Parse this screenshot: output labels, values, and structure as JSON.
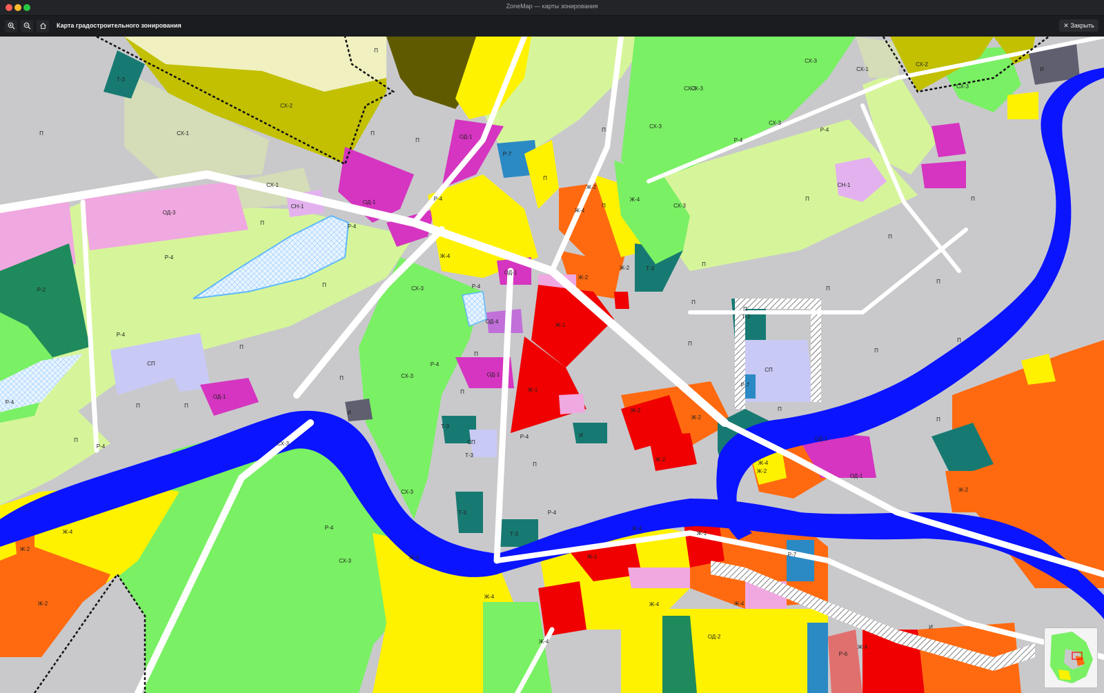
{
  "window": {
    "title": "ZoneMap — карты зонирования"
  },
  "toolbar": {
    "zoom_in_icon": "zoom-in-icon",
    "zoom_out_icon": "zoom-out-icon",
    "home_icon": "home-icon",
    "map_title": "Карта градостроительного зонирования",
    "close_label": "Закрыть"
  },
  "colors": {
    "П": "#c9c9cc",
    "Ж-1": "#f00000",
    "Ж-2": "#ff6a10",
    "Ж-4": "#fff200",
    "ОД-1": "#d535c0",
    "ОД-2": "#a84bb8",
    "ОД-3": "#f0a8e0",
    "ОД-4": "#c070d8",
    "СХ-1": "#d4dcb8",
    "СХ-2": "#c2c000",
    "СХ-3": "#7af064",
    "Р-2": "#1f8a5c",
    "Р-4": "#d6f59a",
    "Р-6": "#e0706e",
    "Р-7": "#2b8ac4",
    "Т-3": "#177a72",
    "И": "#5f5f6f",
    "СП": "#c9c9f5",
    "СН-1": "#e3b2ee",
    "water": "#0a14ff",
    "road": "#ffffff"
  },
  "labels": [
    {
      "t": "П"
    },
    {
      "t": "П"
    },
    {
      "t": "П"
    },
    {
      "t": "П"
    },
    {
      "t": "П"
    },
    {
      "t": "П"
    },
    {
      "t": "П"
    },
    {
      "t": "П"
    },
    {
      "t": "П"
    },
    {
      "t": "П"
    },
    {
      "t": "П"
    },
    {
      "t": "П"
    },
    {
      "t": "П"
    },
    {
      "t": "П"
    },
    {
      "t": "П"
    },
    {
      "t": "П"
    },
    {
      "t": "П"
    },
    {
      "t": "П"
    },
    {
      "t": "П"
    },
    {
      "t": "П"
    },
    {
      "t": "П"
    },
    {
      "t": "П"
    },
    {
      "t": "П"
    },
    {
      "t": "П"
    },
    {
      "t": "П"
    },
    {
      "t": "П"
    },
    {
      "t": "П"
    },
    {
      "t": "П"
    },
    {
      "t": "П"
    },
    {
      "t": "П"
    },
    {
      "t": "СХ-2"
    },
    {
      "t": "СХ-1"
    },
    {
      "t": "СХ-1"
    },
    {
      "t": "СХ-3"
    },
    {
      "t": "СХ-3"
    },
    {
      "t": "СХ-3"
    },
    {
      "t": "СХ-3"
    },
    {
      "t": "СХ-3"
    },
    {
      "t": "СХ-3"
    },
    {
      "t": "СХ-1"
    },
    {
      "t": "СХ-2"
    },
    {
      "t": "СХ-3"
    },
    {
      "t": "СХ-3"
    },
    {
      "t": "СХ-3"
    },
    {
      "t": "СХ-3"
    },
    {
      "t": "СХ-3"
    },
    {
      "t": "СХ-3"
    },
    {
      "t": "ОД-3"
    },
    {
      "t": "ОД-1"
    },
    {
      "t": "ОД-1"
    },
    {
      "t": "ОД-1"
    },
    {
      "t": "ОД-1"
    },
    {
      "t": "ОД-1"
    },
    {
      "t": "ОД-1"
    },
    {
      "t": "ОД-1"
    },
    {
      "t": "ОД-2"
    },
    {
      "t": "Р-4"
    },
    {
      "t": "Р-4"
    },
    {
      "t": "Р-4"
    },
    {
      "t": "Р-4"
    },
    {
      "t": "Р-4"
    },
    {
      "t": "Р-4"
    },
    {
      "t": "Р-4"
    },
    {
      "t": "Р-4"
    },
    {
      "t": "Р-4"
    },
    {
      "t": "Р-4"
    },
    {
      "t": "Р-4"
    },
    {
      "t": "Р-4"
    },
    {
      "t": "Р-4"
    },
    {
      "t": "Р-2"
    },
    {
      "t": "Р-7"
    },
    {
      "t": "Р-7"
    },
    {
      "t": "Р-7"
    },
    {
      "t": "Р-6"
    },
    {
      "t": "Ж-1"
    },
    {
      "t": "Ж-1"
    },
    {
      "t": "Ж-1"
    },
    {
      "t": "Ж-1"
    },
    {
      "t": "Ж-2"
    },
    {
      "t": "Ж-2"
    },
    {
      "t": "Ж-2"
    },
    {
      "t": "Ж-2"
    },
    {
      "t": "Ж-2"
    },
    {
      "t": "Ж-2"
    },
    {
      "t": "Ж-2"
    },
    {
      "t": "Ж-2"
    },
    {
      "t": "Ж-2"
    },
    {
      "t": "Ж-2"
    },
    {
      "t": "Ж-4"
    },
    {
      "t": "Ж-4"
    },
    {
      "t": "Ж-4"
    },
    {
      "t": "Ж-4"
    },
    {
      "t": "Ж-4"
    },
    {
      "t": "Ж-4"
    },
    {
      "t": "Ж-4"
    },
    {
      "t": "Ж-4"
    },
    {
      "t": "Ж-4"
    },
    {
      "t": "Ж-4"
    },
    {
      "t": "Ж-4"
    },
    {
      "t": "Ж-4"
    },
    {
      "t": "Т-3"
    },
    {
      "t": "Т-3"
    },
    {
      "t": "Т-3"
    },
    {
      "t": "Т-3"
    },
    {
      "t": "Т-3"
    },
    {
      "t": "Т-3"
    },
    {
      "t": "Т-3"
    },
    {
      "t": "И"
    },
    {
      "t": "И"
    },
    {
      "t": "И"
    },
    {
      "t": "И"
    },
    {
      "t": "СП"
    },
    {
      "t": "СП"
    },
    {
      "t": "СП"
    },
    {
      "t": "СН-1"
    },
    {
      "t": "СН-1"
    },
    {
      "t": "ОД-4"
    }
  ]
}
